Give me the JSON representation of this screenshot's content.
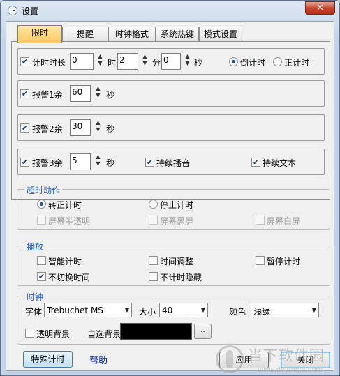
{
  "window": {
    "title": "设置",
    "close_glyph": "✕"
  },
  "tabs": [
    {
      "label": "限时",
      "active": true
    },
    {
      "label": "提醒",
      "active": false
    },
    {
      "label": "时钟格式",
      "active": false
    },
    {
      "label": "系统热键",
      "active": false
    },
    {
      "label": "模式设置",
      "active": false
    }
  ],
  "timer": {
    "label": "计时时长",
    "checked": true,
    "hours": "0",
    "hours_unit": "时",
    "minutes": "2",
    "minutes_unit": "分",
    "seconds": "0",
    "seconds_unit": "秒",
    "countdown_label": "倒计时",
    "countdown_selected": true,
    "countup_label": "正计时",
    "countup_selected": false
  },
  "alarm1": {
    "label": "报警1余",
    "checked": true,
    "value": "60",
    "unit": "秒"
  },
  "alarm2": {
    "label": "报警2余",
    "checked": true,
    "value": "30",
    "unit": "秒"
  },
  "alarm3": {
    "label": "报警3余",
    "checked": true,
    "value": "5",
    "unit": "秒",
    "sound_label": "持续播音",
    "sound_checked": true,
    "text_label": "持续文本",
    "text_checked": true
  },
  "timeout": {
    "title": "超时动作",
    "forward_label": "转正计时",
    "forward_selected": true,
    "stop_label": "停止计时",
    "stop_selected": false,
    "semi_label": "屏幕半透明",
    "black_label": "屏幕黑屏",
    "white_label": "屏幕白屏"
  },
  "hotkeys": {
    "title": "播放",
    "smart_label": "智能计时",
    "smart_checked": false,
    "adjust_label": "时间调整",
    "adjust_checked": false,
    "pause_label": "暂停计时",
    "pause_checked": false,
    "noswitch_label": "不切换时间",
    "noswitch_checked": true,
    "hide_label": "不计时隐藏",
    "hide_checked": false
  },
  "clock": {
    "title": "时钟",
    "font_label": "字体",
    "font_value": "Trebuchet MS",
    "size_label": "大小",
    "size_value": "40",
    "color_label": "颜色",
    "color_value": "浅绿",
    "transparent_label": "透明背景",
    "transparent_checked": false,
    "custom_bg_label": "自选背景",
    "custom_bg_color": "#000000",
    "browse_label": ".."
  },
  "footer": {
    "special_label": "特殊计时",
    "help_label": "帮助",
    "apply_label": "应用",
    "close_label": "关闭"
  },
  "watermark": {
    "text": "当下软件园",
    "url": "www.downxia.com"
  },
  "colors": {
    "active_tab": "#ffc861",
    "group_title": "#1f62c2",
    "link": "#0a2fa8"
  }
}
